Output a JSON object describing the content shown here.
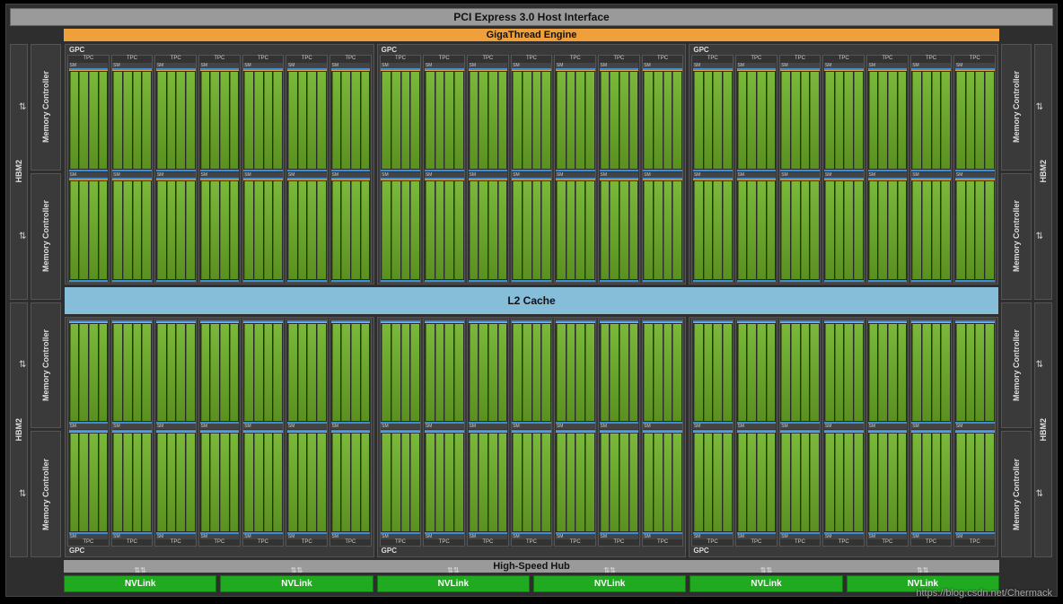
{
  "pci_label": "PCI Express 3.0 Host Interface",
  "giga_label": "GigaThread Engine",
  "l2_label": "L2 Cache",
  "hub_label": "High-Speed Hub",
  "nvlink_label": "NVLink",
  "nvlink_count": 6,
  "hbm_label": "HBM2",
  "mc_label": "Memory Controller",
  "gpc_label": "GPC",
  "tpc_label": "TPC",
  "sm_label": "SM",
  "watermark": "https://blog.csdn.net/Chermack",
  "layout": {
    "gpc_rows": 2,
    "gpcs_per_row": 3,
    "tpcs_per_gpc": 7,
    "sms_per_tpc": 2,
    "cores_per_sm": 4,
    "hbm_per_side": 2,
    "mc_per_side": 4
  }
}
